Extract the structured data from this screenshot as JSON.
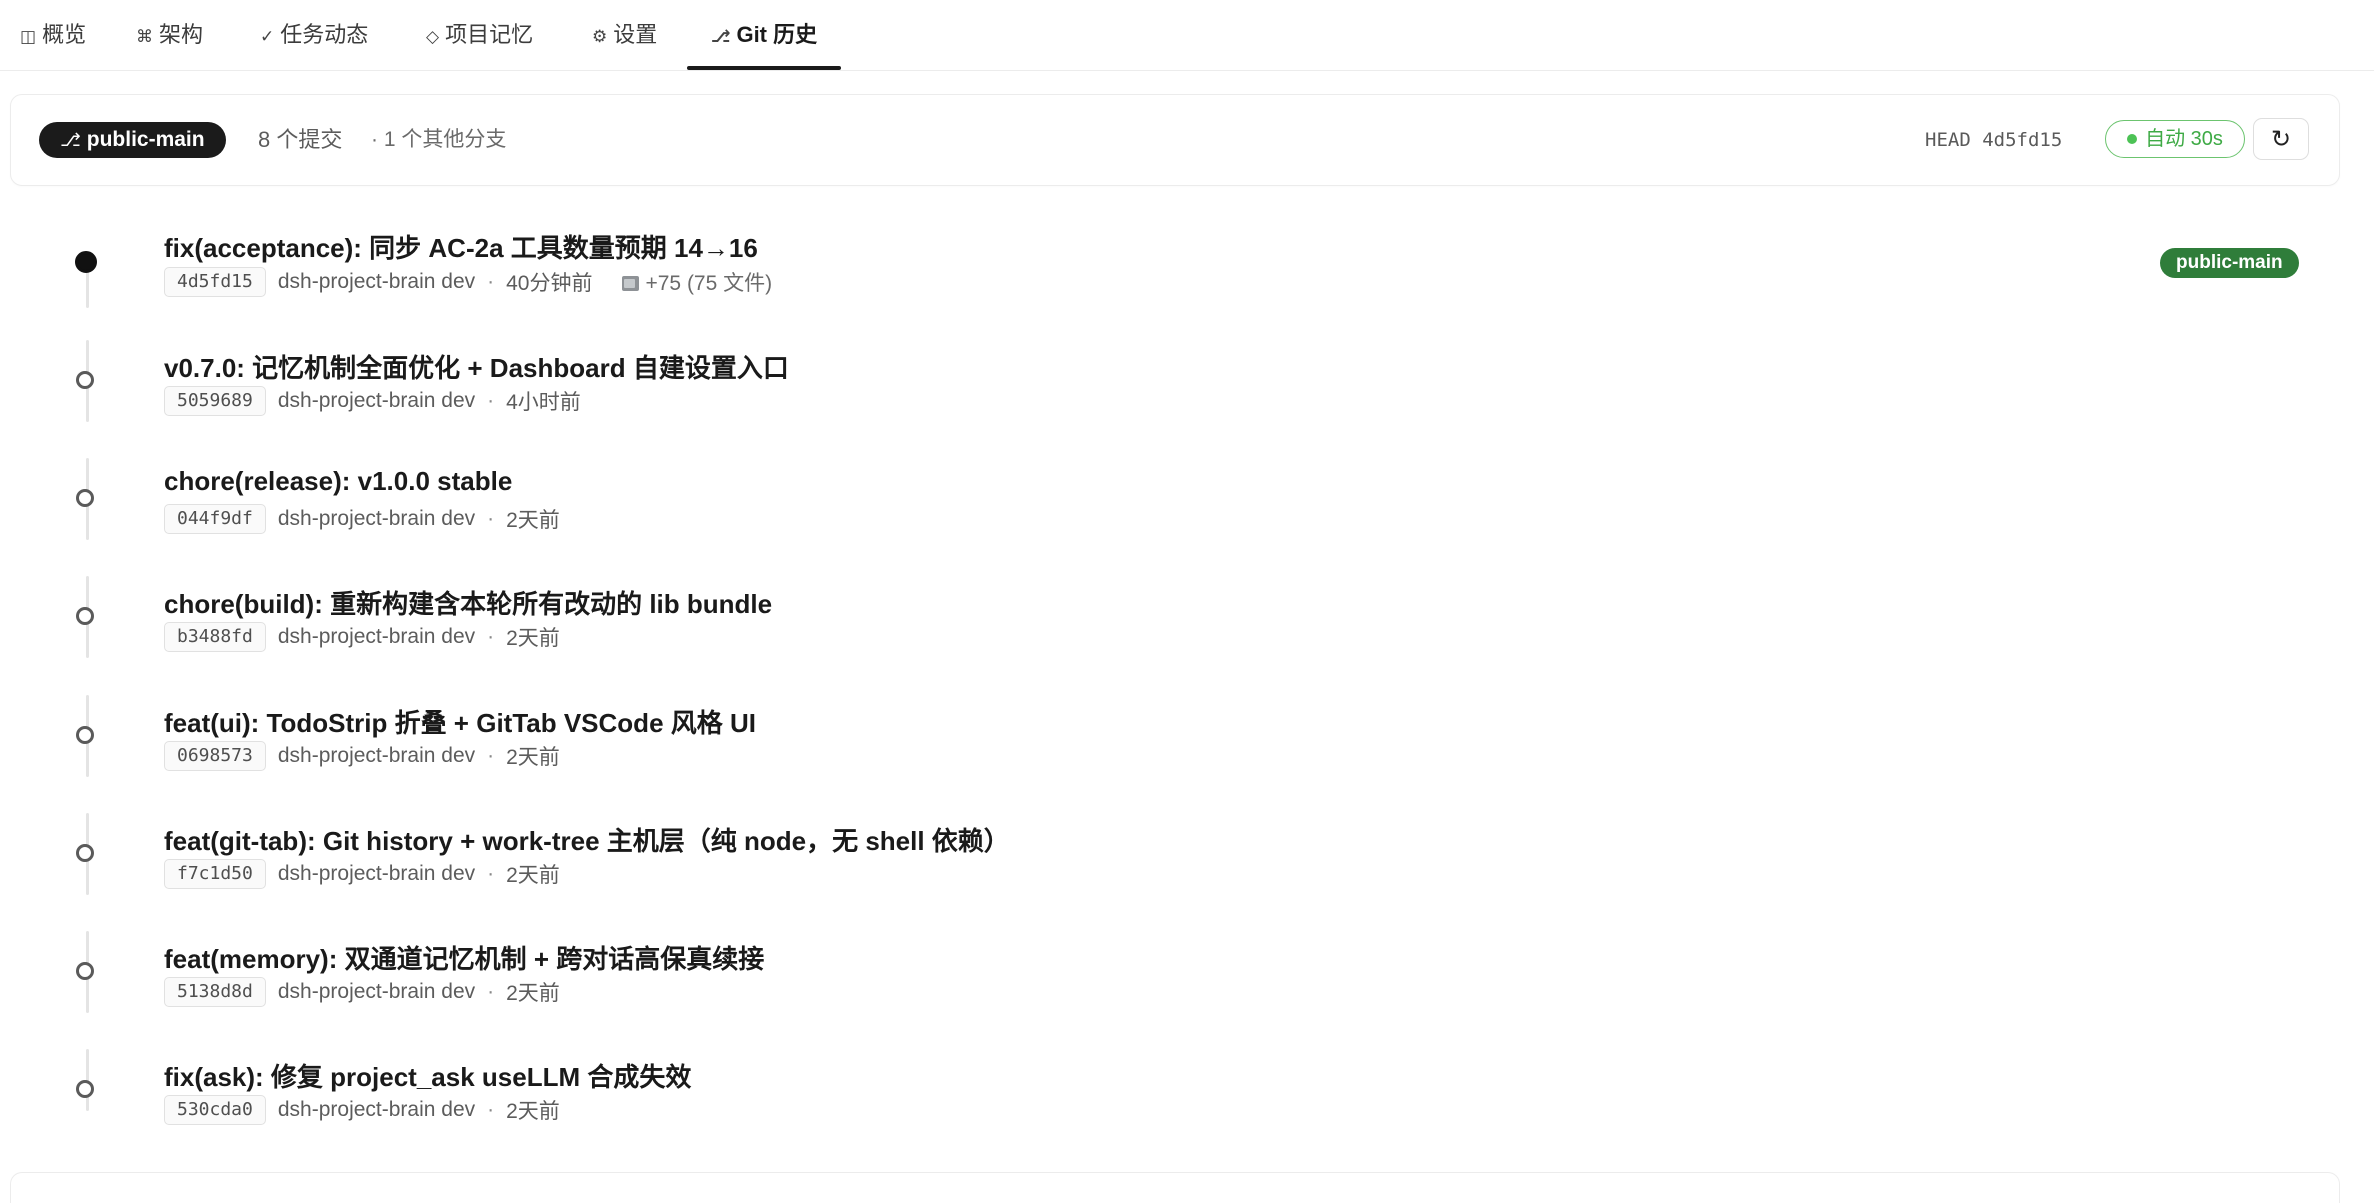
{
  "tabs": [
    {
      "icon": "◫",
      "label": "概览"
    },
    {
      "icon": "⌘",
      "label": "架构"
    },
    {
      "icon": "✓",
      "label": "任务动态"
    },
    {
      "icon": "◇",
      "label": "项目记忆"
    },
    {
      "icon": "⚙",
      "label": "设置"
    },
    {
      "icon": "⎇",
      "label": "Git 历史",
      "active": true
    }
  ],
  "summary": {
    "branch_icon": "⎇",
    "branch": "public-main",
    "commit_count": "8 个提交",
    "other_branches": "· 1 个其他分支",
    "head": "HEAD 4d5fd15",
    "auto_refresh": "自动 30s",
    "refresh_icon": "↻"
  },
  "commits": [
    {
      "title": "fix(acceptance): 同步 AC-2a 工具数量预期 14→16",
      "hash": "4d5fd15",
      "author": "dsh-project-brain dev",
      "sep": "·",
      "time": "40分钟前",
      "files": "+75 (75 文件)",
      "ref": "public-main",
      "head": true
    },
    {
      "title": "v0.7.0: 记忆机制全面优化 + Dashboard 自建设置入口",
      "hash": "5059689",
      "author": "dsh-project-brain dev",
      "sep": "·",
      "time": "4小时前"
    },
    {
      "title": "chore(release): v1.0.0 stable",
      "hash": "044f9df",
      "author": "dsh-project-brain dev",
      "sep": "·",
      "time": "2天前"
    },
    {
      "title": "chore(build): 重新构建含本轮所有改动的 lib bundle",
      "hash": "b3488fd",
      "author": "dsh-project-brain dev",
      "sep": "·",
      "time": "2天前"
    },
    {
      "title": "feat(ui): TodoStrip 折叠 + GitTab VSCode 风格 UI",
      "hash": "0698573",
      "author": "dsh-project-brain dev",
      "sep": "·",
      "time": "2天前"
    },
    {
      "title": "feat(git-tab): Git history + work-tree 主机层（纯 node，无 shell 依赖）",
      "hash": "f7c1d50",
      "author": "dsh-project-brain dev",
      "sep": "·",
      "time": "2天前"
    },
    {
      "title": "feat(memory): 双通道记忆机制 + 跨对话高保真续接",
      "hash": "5138d8d",
      "author": "dsh-project-brain dev",
      "sep": "·",
      "time": "2天前"
    },
    {
      "title": "fix(ask): 修复 project_ask useLLM 合成失效",
      "hash": "530cda0",
      "author": "dsh-project-brain dev",
      "sep": "·",
      "time": "2天前"
    }
  ]
}
